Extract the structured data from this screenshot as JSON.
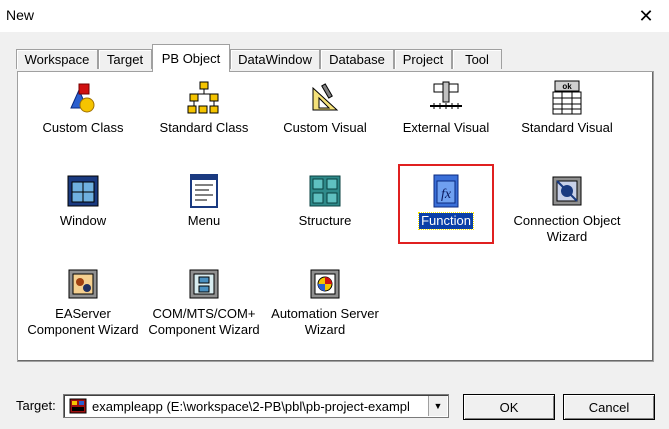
{
  "window": {
    "title": "New"
  },
  "tabs": [
    {
      "label": "Workspace"
    },
    {
      "label": "Target"
    },
    {
      "label": "PB Object",
      "active": true
    },
    {
      "label": "DataWindow"
    },
    {
      "label": "Database"
    },
    {
      "label": "Project"
    },
    {
      "label": "Tool"
    }
  ],
  "items": [
    {
      "label": "Custom Class",
      "icon": "custom-class-icon"
    },
    {
      "label": "Standard Class",
      "icon": "standard-class-icon"
    },
    {
      "label": "Custom Visual",
      "icon": "custom-visual-icon"
    },
    {
      "label": "External Visual",
      "icon": "external-visual-icon"
    },
    {
      "label": "Standard Visual",
      "icon": "standard-visual-icon"
    },
    {
      "label": "Window",
      "icon": "window-icon"
    },
    {
      "label": "Menu",
      "icon": "menu-icon"
    },
    {
      "label": "Structure",
      "icon": "structure-icon"
    },
    {
      "label": "Function",
      "icon": "function-icon",
      "selected": true
    },
    {
      "label": "Connection Object\nWizard",
      "icon": "connection-object-wizard-icon"
    },
    {
      "label": "EAServer\nComponent Wizard",
      "icon": "easerver-wizard-icon"
    },
    {
      "label": "COM/MTS/COM+\nComponent Wizard",
      "icon": "com-wizard-icon"
    },
    {
      "label": "Automation Server\nWizard",
      "icon": "automation-server-wizard-icon"
    }
  ],
  "standard_visual_badge": "ok",
  "target": {
    "label": "Target:",
    "value": "exampleapp (E:\\workspace\\2-PB\\pbl\\pb-project-exampl"
  },
  "buttons": {
    "ok": "OK",
    "cancel": "Cancel"
  },
  "colors": {
    "selection": "#0a3fa8",
    "highlight_box": "#e02020"
  }
}
